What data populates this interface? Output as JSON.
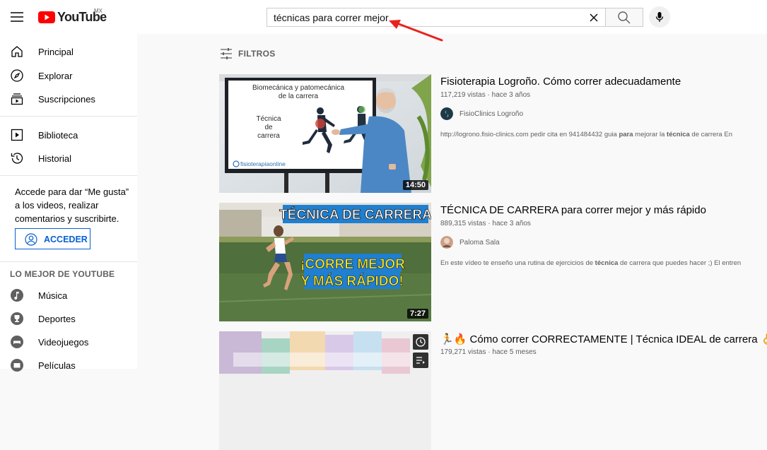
{
  "header": {
    "logo_text": "YouTube",
    "logo_region": "MX",
    "search_value": "técnicas para correr mejor"
  },
  "sidebar": {
    "primary": [
      {
        "label": "Principal",
        "icon": "home-icon"
      },
      {
        "label": "Explorar",
        "icon": "compass-icon"
      },
      {
        "label": "Suscripciones",
        "icon": "subscriptions-icon"
      }
    ],
    "library": [
      {
        "label": "Biblioteca",
        "icon": "library-icon"
      },
      {
        "label": "Historial",
        "icon": "history-icon"
      }
    ],
    "signin_prompt": "Accede para dar “Me gusta” a los videos, realizar comentarios y suscribirte.",
    "signin_button": "ACCEDER",
    "best_of_title": "LO MEJOR DE YOUTUBE",
    "best_of": [
      {
        "label": "Música",
        "icon": "music-icon"
      },
      {
        "label": "Deportes",
        "icon": "trophy-icon"
      },
      {
        "label": "Videojuegos",
        "icon": "gaming-icon"
      },
      {
        "label": "Películas",
        "icon": "movies-icon"
      }
    ]
  },
  "filters": {
    "label": "FILTROS"
  },
  "results": [
    {
      "title": "Fisioterapia Logroño. Cómo correr adecuadamente",
      "views": "117,219 vistas",
      "age": "hace 3 años",
      "channel": "FisioClinics Logroño",
      "desc_a": "http://logrono.fisio-clinics.com pedir cita en 941484432 guia ",
      "desc_b": "para",
      "desc_c": " mejorar la ",
      "desc_d": "técnica",
      "desc_e": " de carrera En ",
      "duration": "14:50",
      "thumb_title_1": "Biomecánica y patomecánica",
      "thumb_title_2": "de la carrera",
      "thumb_sub_1": "Técnica",
      "thumb_sub_2": "de",
      "thumb_sub_3": "carrera",
      "thumb_brand": "fisioterapiaonline"
    },
    {
      "title": "TÉCNICA DE CARRERA para correr mejor y más rápido",
      "views": "889,315 vistas",
      "age": "hace 3 años",
      "channel": "Paloma Sala",
      "desc_a": "En este vídeo te enseño una rutina de ejercicios de ",
      "desc_b": "técnica",
      "desc_c": " de carrera que puedes hacer ;) El entren",
      "duration": "7:27",
      "thumb_banner": "TÉCNICA DE CARRERA",
      "thumb_caption_1": "¡CORRE MEJOR",
      "thumb_caption_2": "Y MÁS RÁPIDO!"
    },
    {
      "title": "🏃🔥 Cómo correr CORRECTAMENTE | Técnica IDEAL de carrera 👌",
      "views": "179,271 vistas",
      "age": "hace 5 meses"
    }
  ],
  "colors": {
    "brand_red": "#ff0000",
    "link_blue": "#065fd4",
    "annotation_red": "#e8231e"
  }
}
